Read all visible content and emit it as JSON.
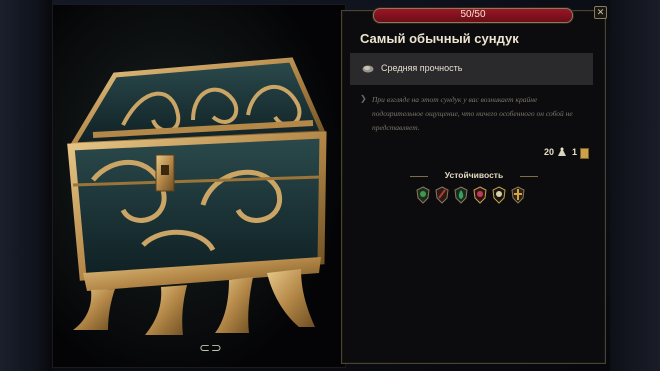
{
  "health": {
    "text": "50/50",
    "current": 50,
    "max": 50
  },
  "item": {
    "title": "Самый обычный сундук",
    "rarity": "Средняя прочность",
    "description": "При взгляде на этот сундук у вас возникает крайне подозрительное ощущение, что ничего особенного он собой не представляет.",
    "weight": "20",
    "value": "1"
  },
  "resistances": {
    "header": "Устойчивость",
    "icons": [
      {
        "name": "resist-poison-icon",
        "color": "#3e9a4a"
      },
      {
        "name": "resist-piercing-icon",
        "color": "#b33a30"
      },
      {
        "name": "resist-acid-icon",
        "color": "#3aa060"
      },
      {
        "name": "resist-psychic-icon",
        "color": "#c23a5a"
      },
      {
        "name": "resist-necrotic-icon",
        "color": "#2c2c2c"
      },
      {
        "name": "resist-radiant-icon",
        "color": "#d8a640"
      }
    ]
  },
  "preview": {
    "rotate_symbol": "⊂⊃"
  },
  "colors": {
    "accent_gold": "#8b7a5a",
    "hp_red": "#9a1626",
    "panel_bg": "#0c0c0e"
  }
}
